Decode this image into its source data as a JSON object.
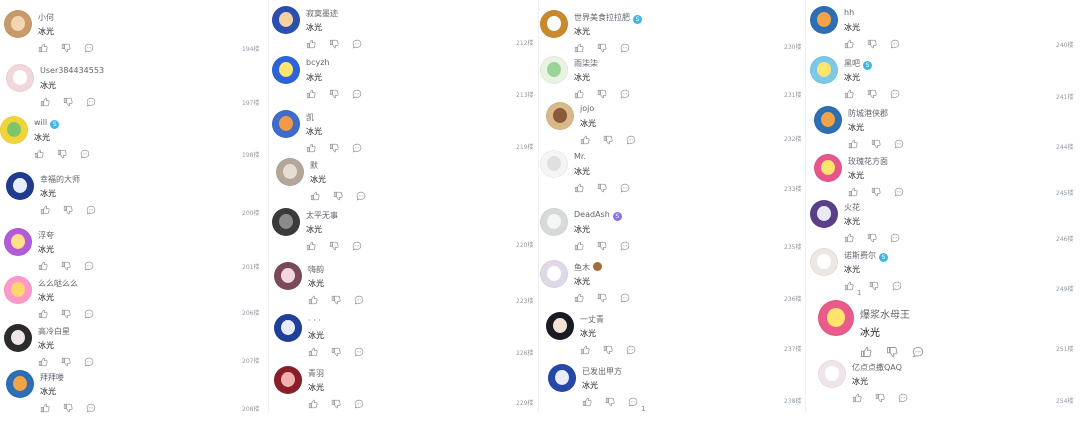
{
  "comment_text": "冰光",
  "columns": [
    {
      "comments": [
        {
          "name": "小何",
          "avatar": {
            "bg": "#c89a6b",
            "face": "#f2d6b3"
          }
        },
        {
          "name": "User384434553",
          "avatar": {
            "bg": "#f1d7dc",
            "face": "#ffffff"
          }
        },
        {
          "name": "will",
          "badge": "blue",
          "avatar": {
            "bg": "#f0d43a",
            "face": "#7cc56a"
          }
        },
        {
          "name": "幸福的大师",
          "avatar": {
            "bg": "#1f3a8f",
            "face": "#e8ecff"
          }
        },
        {
          "name": "浮夸",
          "avatar": {
            "bg": "#b45ad6",
            "face": "#ffe08a"
          }
        },
        {
          "name": "么么哒么么",
          "avatar": {
            "bg": "#ff9ac8",
            "face": "#ffd66b"
          }
        },
        {
          "name": "高冷白星",
          "avatar": {
            "bg": "#2b2b2b",
            "face": "#f0e6e6"
          }
        },
        {
          "name": "拜拜喽",
          "avatar": {
            "bg": "#2c6fb5",
            "face": "#f2a347"
          }
        }
      ],
      "floors": []
    },
    {
      "comments": [
        {
          "name": "寂寞墨迹",
          "avatar": {
            "bg": "#2a4fb0",
            "face": "#f5d0a0"
          }
        },
        {
          "name": "bcyzh",
          "avatar": {
            "bg": "#2d63d6",
            "face": "#ffe46e"
          }
        },
        {
          "name": "凯",
          "avatar": {
            "bg": "#3e6cc8",
            "face": "#f09a45"
          }
        },
        {
          "name": "默",
          "avatar": {
            "bg": "#b3a79a",
            "face": "#e6ddd3"
          }
        },
        {
          "name": "太平无事",
          "avatar": {
            "bg": "#3b3b3b",
            "face": "#8b8b8b"
          }
        },
        {
          "name": "嗨韵",
          "avatar": {
            "bg": "#7a4a5a",
            "face": "#f3d7de"
          }
        },
        {
          "name": "· · ·",
          "avatar": {
            "bg": "#1e3f9a",
            "face": "#e8ecff"
          }
        },
        {
          "name": "青羽",
          "avatar": {
            "bg": "#8a1f2b",
            "face": "#f2b0b0"
          }
        }
      ],
      "floors": [
        "194楼",
        "197楼",
        "198楼",
        "200楼",
        "201楼",
        "206楼",
        "207楼",
        "208楼"
      ]
    },
    {
      "comments": [
        {
          "name": "世界美食拉拉肥",
          "badge": "blue",
          "avatar": {
            "bg": "#c98a2e",
            "face": "#ffffff"
          }
        },
        {
          "name": "雨柒柒",
          "avatar": {
            "bg": "#e9f3e3",
            "face": "#9ad39a"
          }
        },
        {
          "name": "jojo",
          "avatar": {
            "bg": "#d9b98a",
            "face": "#8a5a3a"
          }
        },
        {
          "name": "Mr.",
          "avatar": {
            "bg": "#f5f5f5",
            "face": "#e0e0e0"
          }
        },
        {
          "name": "DeadAsh",
          "badge": "purple",
          "avatar": {
            "bg": "#d7dbd8",
            "face": "#f4f6f5"
          }
        },
        {
          "name": "鱼木",
          "badge": "brown",
          "avatar": {
            "bg": "#ded8e8",
            "face": "#ffffff"
          }
        },
        {
          "name": "一丈青",
          "avatar": {
            "bg": "#1a1a22",
            "face": "#f2e2d6"
          }
        },
        {
          "name": "已发出甲方",
          "avatar": {
            "bg": "#2447a8",
            "face": "#e8ecff"
          }
        }
      ],
      "floors": [
        "212楼",
        "213楼",
        "219楼",
        "220楼",
        "223楼",
        "226楼",
        "229楼"
      ],
      "last_reply_count": "1"
    },
    {
      "comments": [
        {
          "name": "hh",
          "avatar": {
            "bg": "#2c6fb5",
            "face": "#f2a347"
          }
        },
        {
          "name": "黑吧",
          "badge": "blue",
          "avatar": {
            "bg": "#7bc8e8",
            "face": "#ffe46e"
          }
        },
        {
          "name": "防城港侠郡",
          "avatar": {
            "bg": "#2c6fb5",
            "face": "#f2a347"
          }
        },
        {
          "name": "玫瑰花方面",
          "avatar": {
            "bg": "#e6568c",
            "face": "#ffe46e"
          }
        },
        {
          "name": "火花",
          "avatar": {
            "bg": "#5a3f8a",
            "face": "#eaeaf5"
          }
        },
        {
          "name": "诺斯费尔",
          "badge": "blue",
          "avatar": {
            "bg": "#ece7e3",
            "face": "#ffffff"
          },
          "like_count": "1"
        },
        {
          "name": "爆浆水母王",
          "big": true,
          "avatar": {
            "bg": "#ea5a8a",
            "face": "#ffe46e"
          }
        },
        {
          "name": "亿点点撒QAQ",
          "avatar": {
            "bg": "#f0e4ec",
            "face": "#ffffff"
          }
        }
      ],
      "floors_left": [
        "230楼",
        "231楼",
        "232楼",
        "233楼",
        "235楼",
        "236楼",
        "237楼",
        "238楼"
      ],
      "floors_right": [
        "240楼",
        "241楼",
        "244楼",
        "245楼",
        "246楼",
        "249楼",
        "251楼",
        "254楼"
      ]
    }
  ]
}
